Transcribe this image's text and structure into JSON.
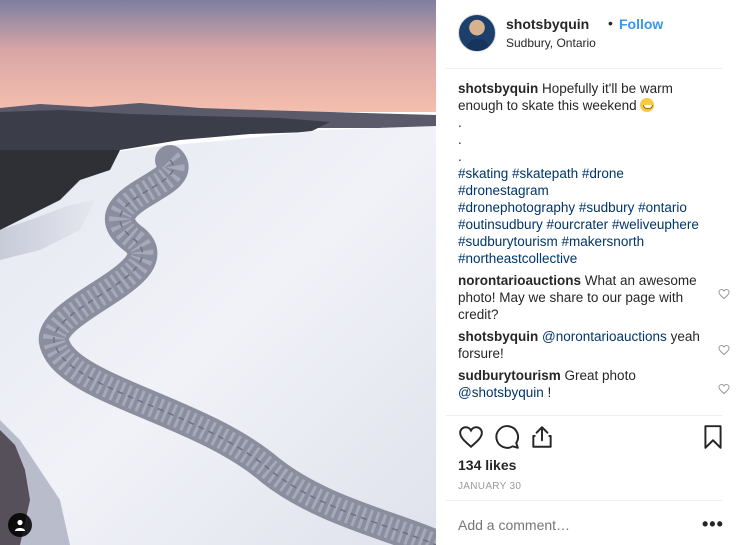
{
  "post": {
    "username": "shotsbyquin",
    "separator": "•",
    "follow_label": "Follow",
    "location": "Sudbury, Ontario"
  },
  "caption": {
    "username": "shotsbyquin",
    "text": "Hopefully it'll be warm enough to skate this weekend",
    "emoji": "grinning-face-emoji",
    "dots": [
      ".",
      ".",
      "."
    ],
    "hashtags_line1": "#skating #skatepath #drone #dronestagram",
    "hashtags_line2": "#dronephotography #sudbury #ontario",
    "hashtags_line3": "#outinsudbury #ourcrater #weliveuphere",
    "hashtags_line4": "#sudburytourism #makersnorth",
    "hashtags_line5": "#northeastcollective"
  },
  "comments": [
    {
      "user": "norontarioauctions",
      "text": "What an awesome photo! May we share to our page with credit?"
    },
    {
      "user": "shotsbyquin",
      "mention": "@norontarioauctions",
      "text": "yeah forsure!"
    },
    {
      "user": "sudburytourism",
      "text": "Great photo",
      "mention": "@shotsbyquin",
      "suffix": "!"
    }
  ],
  "stats": {
    "likes": "134 likes",
    "date": "JANUARY 30"
  },
  "add_comment": {
    "placeholder": "Add a comment…"
  },
  "more_label": "•••",
  "icons": [
    "heart-icon",
    "comment-icon",
    "share-icon",
    "bookmark-icon",
    "user-tag-icon",
    "more-options-icon"
  ],
  "colors": {
    "link": "#3897f0",
    "hashtag": "#003569",
    "muted": "#999999"
  }
}
